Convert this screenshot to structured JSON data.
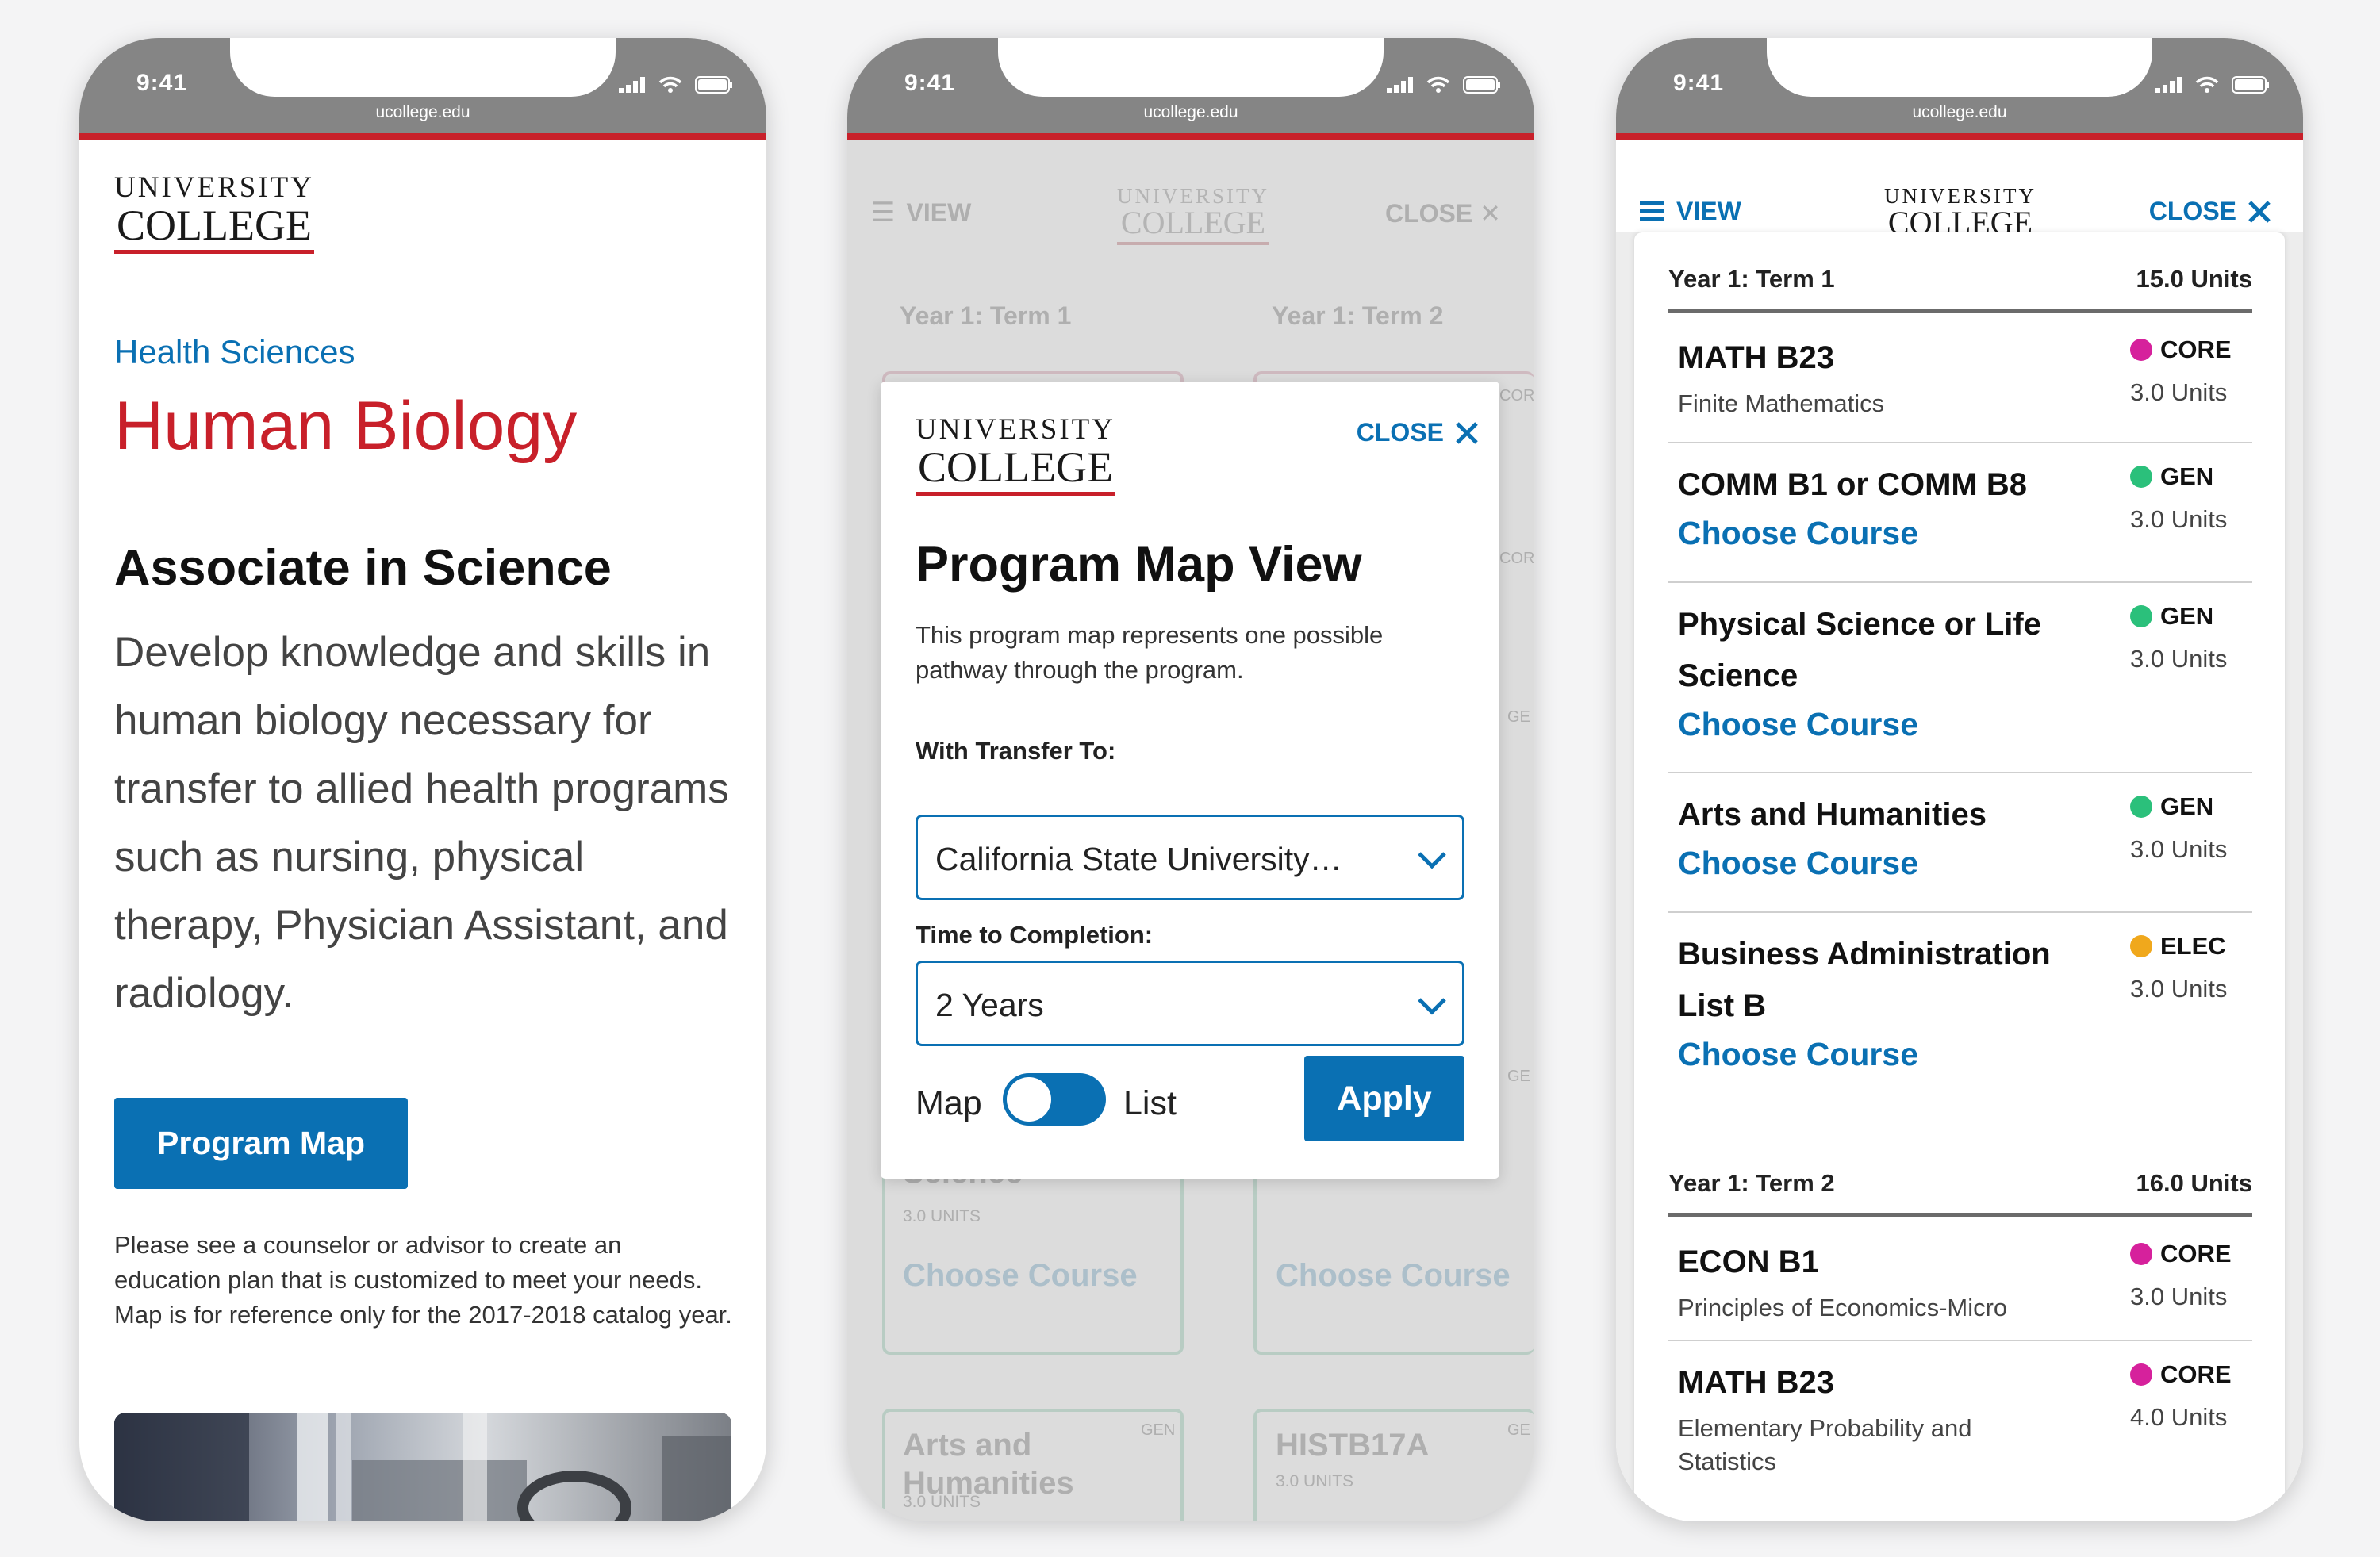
{
  "status_bar": {
    "time": "9:41",
    "url": "ucollege.edu"
  },
  "logo": {
    "line1": "UNIVERSITY",
    "line2": "COLLEGE"
  },
  "colors": {
    "brand_red": "#c8202a",
    "link_blue": "#0a70b3",
    "core": "#d6219c",
    "gen": "#2bc07b",
    "elec": "#f0a81c"
  },
  "screen1": {
    "department": "Health Sciences",
    "program": "Human Biology",
    "degree": "Associate in Science",
    "description": "Develop knowledge and skills in human biology necessary for transfer to allied health programs such as nursing, physical therapy, Physician Assistant, and radiology.",
    "button": "Program Map",
    "note": "Please see a counselor or advisor to create an education plan that is customized to meet your needs. Map is for reference only for the 2017-2018 catalog year."
  },
  "screen2": {
    "nav": {
      "view": "VIEW",
      "close": "CLOSE"
    },
    "bg": {
      "term1": "Year 1: Term 1",
      "term2": "Year 1: Term 2",
      "tag_core": "COR",
      "tag_gen": "GE",
      "science": "Science",
      "units3": "3.0 UNITS",
      "choose": "Choose Course",
      "arts": "Arts and Humanities",
      "gen": "GEN",
      "hist": "HISTB17A"
    },
    "modal": {
      "close": "CLOSE",
      "title": "Program Map View",
      "desc": "This program map represents one possible pathway through the program.",
      "transfer_label": "With Transfer To:",
      "transfer_value": "California State University…",
      "time_label": "Time to Completion:",
      "time_value": "2 Years",
      "toggle_left": "Map",
      "toggle_right": "List",
      "apply": "Apply"
    }
  },
  "screen3": {
    "nav": {
      "view": "VIEW",
      "close": "CLOSE"
    },
    "terms": [
      {
        "name": "Year 1: Term 1",
        "units": "15.0 Units"
      },
      {
        "name": "Year 1: Term 2",
        "units": "16.0 Units"
      }
    ],
    "courses": [
      {
        "name": "MATH B23",
        "sub": "Finite Mathematics",
        "tag": "CORE",
        "units": "3.0 Units"
      },
      {
        "name": "COMM B1 or COMM B8",
        "action": "Choose Course",
        "tag": "GEN",
        "units": "3.0 Units"
      },
      {
        "name1": "Physical Science or Life",
        "name2": "Science",
        "action": "Choose Course",
        "tag": "GEN",
        "units": "3.0 Units"
      },
      {
        "name": "Arts and Humanities",
        "action": "Choose Course",
        "tag": "GEN",
        "units": "3.0 Units"
      },
      {
        "name1": "Business Administration",
        "name2": "List B",
        "action": "Choose Course",
        "tag": "ELEC",
        "units": "3.0 Units"
      },
      {
        "name": "ECON B1",
        "sub": "Principles of Economics-Micro",
        "tag": "CORE",
        "units": "3.0 Units"
      },
      {
        "name": "MATH B23",
        "sub1": "Elementary Probability and",
        "sub2": "Statistics",
        "tag": "CORE",
        "units": "4.0 Units"
      }
    ]
  }
}
